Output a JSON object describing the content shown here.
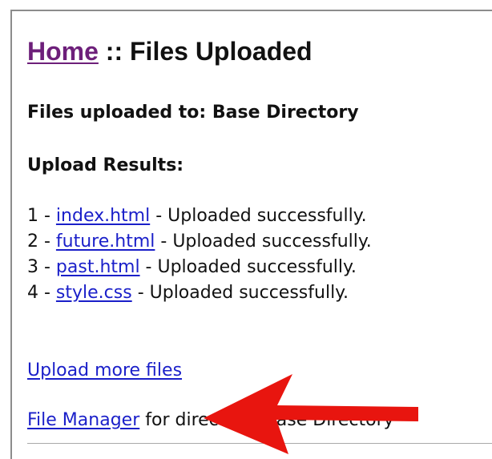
{
  "header": {
    "home_link": "Home",
    "title_separator": " :: ",
    "title": "Files Uploaded"
  },
  "upload_target": {
    "label": "Files uploaded to: Base Directory"
  },
  "results": {
    "heading": "Upload Results:",
    "items": [
      {
        "prefix": "1 - ",
        "file": "index.html",
        "status": " - Uploaded successfully."
      },
      {
        "prefix": "2 - ",
        "file": "future.html",
        "status": " - Uploaded successfully."
      },
      {
        "prefix": "3 - ",
        "file": "past.html",
        "status": " - Uploaded successfully."
      },
      {
        "prefix": "4 - ",
        "file": "style.css",
        "status": " - Uploaded successfully."
      }
    ]
  },
  "actions": {
    "upload_more": "Upload more files",
    "file_manager": "File Manager",
    "file_manager_suffix": " for directory: Base Directory"
  },
  "annotation": {
    "arrow_color": "#e8150f",
    "arrow_icon": "red-arrow-icon"
  },
  "colors": {
    "link": "#1a1fc9",
    "visited_link": "#6d1f7a",
    "text": "#111111"
  }
}
